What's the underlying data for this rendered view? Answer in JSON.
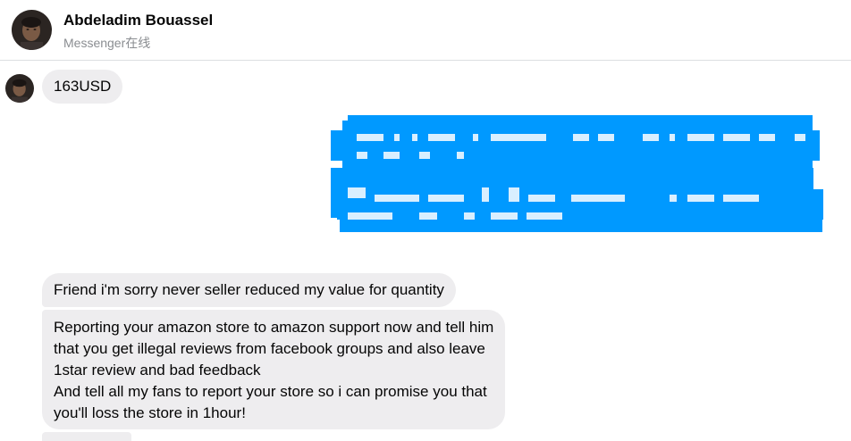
{
  "header": {
    "name": "Abdeladim Bouassel",
    "status": "Messenger在线"
  },
  "messages": [
    {
      "sender": "contact",
      "text": "163USD"
    },
    {
      "sender": "me",
      "redacted": true,
      "color": "#0099ff"
    },
    {
      "sender": "contact",
      "text": "Friend i'm sorry never seller reduced my value for quantity"
    },
    {
      "sender": "contact",
      "lines": [
        "Reporting your amazon store to amazon support now and tell him",
        "that you get illegal reviews from facebook groups and also leave",
        "1star review and bad feedback",
        "And tell all my fans to report your store so i can promise you that",
        "you'll loss the store in 1hour!"
      ]
    }
  ],
  "colors": {
    "incoming_bubble": "#eeedef",
    "outgoing_bubble": "#0099ff",
    "status_text": "#8a8d91",
    "divider": "#dddfe2"
  }
}
